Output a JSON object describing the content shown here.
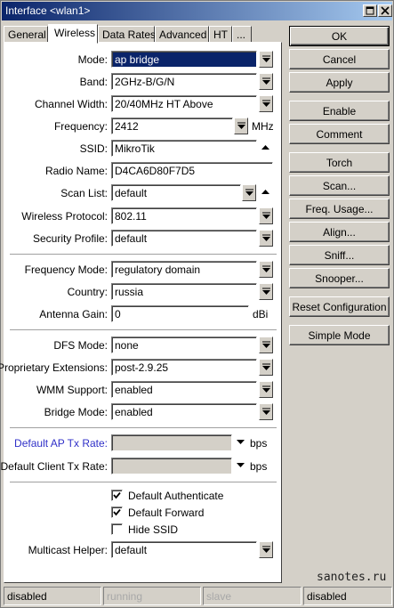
{
  "window": {
    "title": "Interface <wlan1>"
  },
  "tabs": [
    {
      "label": "General"
    },
    {
      "label": "Wireless"
    },
    {
      "label": "Data Rates"
    },
    {
      "label": "Advanced"
    },
    {
      "label": "HT"
    },
    {
      "label": "..."
    }
  ],
  "form": {
    "mode": {
      "label": "Mode:",
      "value": "ap bridge"
    },
    "band": {
      "label": "Band:",
      "value": "2GHz-B/G/N"
    },
    "channel_width": {
      "label": "Channel Width:",
      "value": "20/40MHz HT Above"
    },
    "frequency": {
      "label": "Frequency:",
      "value": "2412",
      "unit": "MHz"
    },
    "ssid": {
      "label": "SSID:",
      "value": "MikroTik"
    },
    "radio_name": {
      "label": "Radio Name:",
      "value": "D4CA6D80F7D5"
    },
    "scan_list": {
      "label": "Scan List:",
      "value": "default"
    },
    "wireless_protocol": {
      "label": "Wireless Protocol:",
      "value": "802.11"
    },
    "security_profile": {
      "label": "Security Profile:",
      "value": "default"
    },
    "frequency_mode": {
      "label": "Frequency Mode:",
      "value": "regulatory domain"
    },
    "country": {
      "label": "Country:",
      "value": "russia"
    },
    "antenna_gain": {
      "label": "Antenna Gain:",
      "value": "0",
      "unit": "dBi"
    },
    "dfs_mode": {
      "label": "DFS Mode:",
      "value": "none"
    },
    "proprietary_extensions": {
      "label": "Proprietary Extensions:",
      "value": "post-2.9.25"
    },
    "wmm_support": {
      "label": "WMM Support:",
      "value": "enabled"
    },
    "bridge_mode": {
      "label": "Bridge Mode:",
      "value": "enabled"
    },
    "default_ap_tx_rate": {
      "label": "Default AP Tx Rate:",
      "value": "",
      "unit": "bps"
    },
    "default_client_tx_rate": {
      "label": "Default Client Tx Rate:",
      "value": "",
      "unit": "bps"
    },
    "default_authenticate": {
      "label": "Default Authenticate",
      "checked": true
    },
    "default_forward": {
      "label": "Default Forward",
      "checked": true
    },
    "hide_ssid": {
      "label": "Hide SSID",
      "checked": false
    },
    "multicast_helper": {
      "label": "Multicast Helper:",
      "value": "default"
    }
  },
  "buttons": {
    "ok": "OK",
    "cancel": "Cancel",
    "apply": "Apply",
    "enable": "Enable",
    "comment": "Comment",
    "torch": "Torch",
    "scan": "Scan...",
    "freq_usage": "Freq. Usage...",
    "align": "Align...",
    "sniff": "Sniff...",
    "snooper": "Snooper...",
    "reset_configuration": "Reset Configuration",
    "simple_mode": "Simple Mode"
  },
  "watermark": "sanotes.ru",
  "status": [
    "disabled",
    "running",
    "slave",
    "disabled"
  ]
}
